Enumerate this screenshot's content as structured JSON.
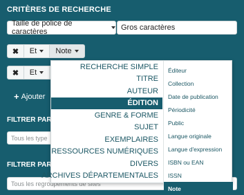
{
  "header": {
    "title": "CRITÈRES DE RECHERCHE"
  },
  "row1": {
    "select_label": "Taille de police de caractères",
    "value": "Gros caractères"
  },
  "row2": {
    "remove_glyph": "✖",
    "operator": "Et",
    "field": "Note"
  },
  "row3": {
    "remove_glyph": "✖",
    "operator": "Et"
  },
  "add_button": {
    "label": "Ajouter"
  },
  "filter1": {
    "label": "FILTRER PAR",
    "placeholder": "Tous les type"
  },
  "filter2": {
    "label": "FILTRER PAR",
    "placeholder": "Tous les regroupements de sites"
  },
  "menu": {
    "categories": [
      "RECHERCHE SIMPLE",
      "TITRE",
      "AUTEUR",
      "ÉDITION",
      "GENRE & FORME",
      "SUJET",
      "EXEMPLAIRES",
      "RESSOURCES NUMÉRIQUES",
      "DIVERS",
      "ARCHIVES DÉPARTEMENTALES"
    ],
    "active_category": "ÉDITION",
    "fields": [
      "Éditeur",
      "Collection",
      "Date de publication",
      "Périodicité",
      "Public",
      "Langue originale",
      "Langue d'expression",
      "ISBN ou EAN",
      "ISSN",
      "Note"
    ],
    "active_field": "Note"
  },
  "colors": {
    "background": "#175d6e",
    "active": "#175d6e",
    "menu_text": "#1a5663"
  }
}
